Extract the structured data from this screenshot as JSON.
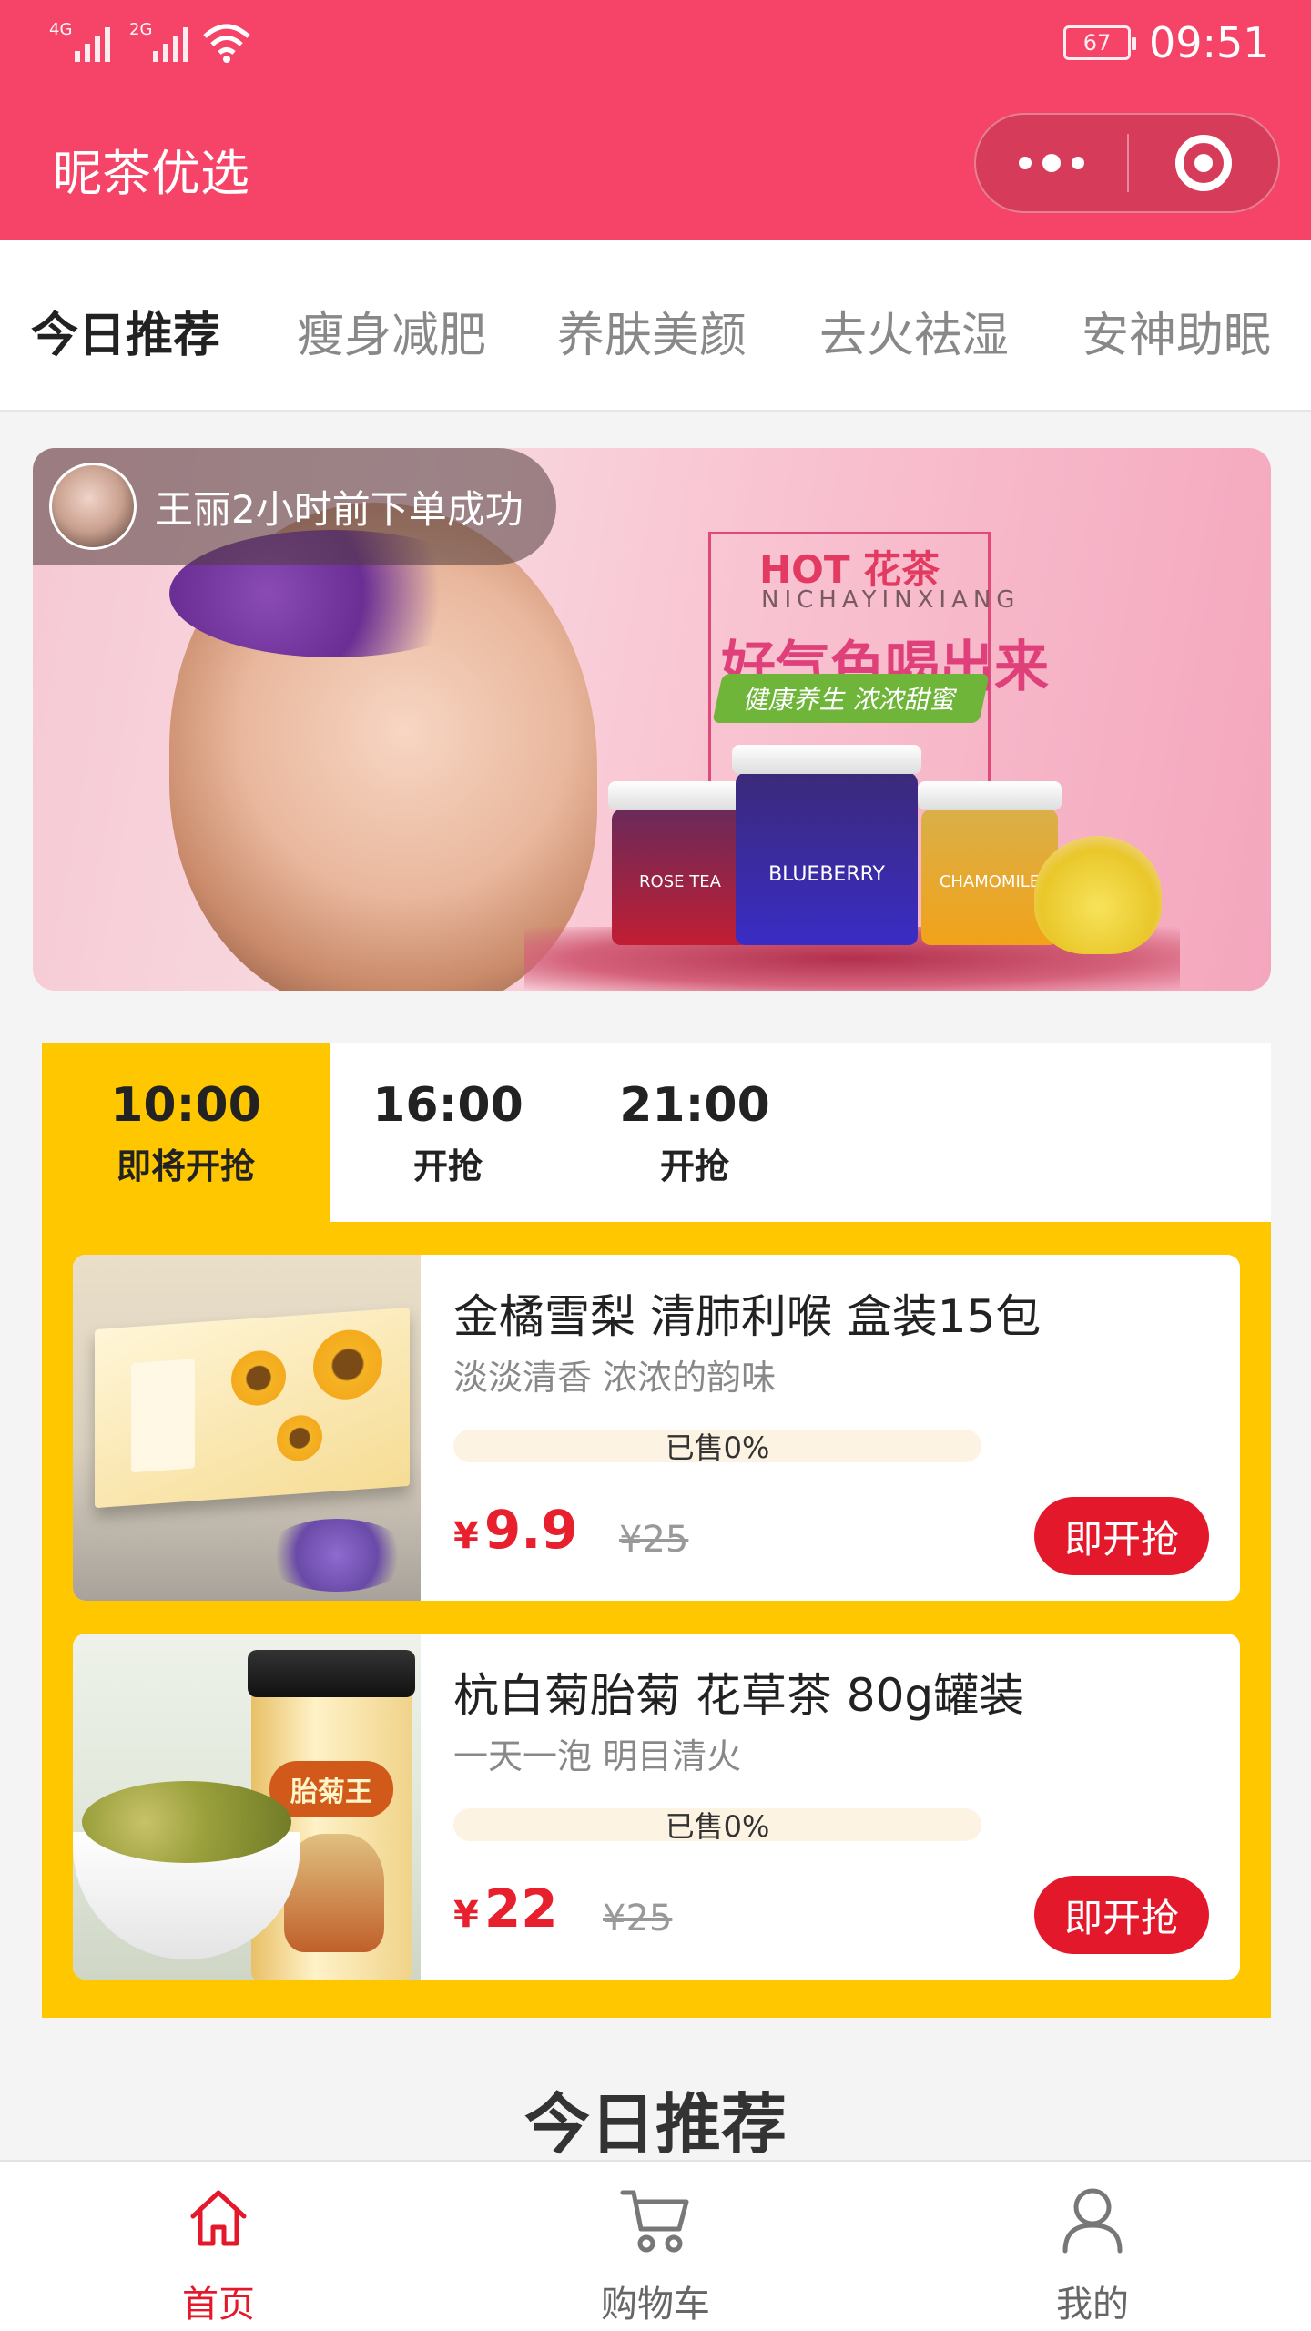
{
  "status_bar": {
    "net1": "4G",
    "net2": "2G",
    "battery": "67",
    "time": "09:51"
  },
  "header": {
    "title": "昵茶优选",
    "more_icon": "more-dots-icon",
    "close_icon": "target-close-icon",
    "color": "#f64468"
  },
  "categories": [
    {
      "label": "今日推荐",
      "active": true
    },
    {
      "label": "瘦身减肥",
      "active": false
    },
    {
      "label": "养肤美颜",
      "active": false
    },
    {
      "label": "去火祛湿",
      "active": false
    },
    {
      "label": "安神助眠",
      "active": false
    }
  ],
  "banner": {
    "notification": "王丽2小时前下单成功",
    "hot_text": "HOT 花茶",
    "pinyin": "NICHAYINXIANG",
    "slogan": "好气色喝出来",
    "tagline": "健康养生 浓浓甜蜜",
    "jars": [
      "ROSE TEA",
      "BLUEBERRY",
      "CHAMOMILE"
    ]
  },
  "flash_sale": {
    "tabs": [
      {
        "time": "10:00",
        "status": "即将开抢",
        "active": true
      },
      {
        "time": "16:00",
        "status": "开抢",
        "active": false
      },
      {
        "time": "21:00",
        "status": "开抢",
        "active": false
      }
    ],
    "products": [
      {
        "name": "金橘雪梨 清肺利喉 盒装15包",
        "subtitle": "淡淡清香 浓浓的韵味",
        "sold": "已售0%",
        "currency": "¥",
        "price": "9.9",
        "original_price": "¥25",
        "button": "即开抢"
      },
      {
        "name": "杭白菊胎菊 花草茶 80g罐装",
        "subtitle": "一天一泡 明目清火",
        "sold": "已售0%",
        "currency": "¥",
        "price": "22",
        "original_price": "¥25",
        "button": "即开抢",
        "tin_label": "胎菊王"
      }
    ]
  },
  "section_title": "今日推荐",
  "tabbar": [
    {
      "label": "首页",
      "icon": "home-icon",
      "active": true
    },
    {
      "label": "购物车",
      "icon": "cart-icon",
      "active": false
    },
    {
      "label": "我的",
      "icon": "user-icon",
      "active": false
    }
  ],
  "colors": {
    "accent": "#e3192b",
    "sale_bg": "#ffc700",
    "header": "#f64468"
  }
}
